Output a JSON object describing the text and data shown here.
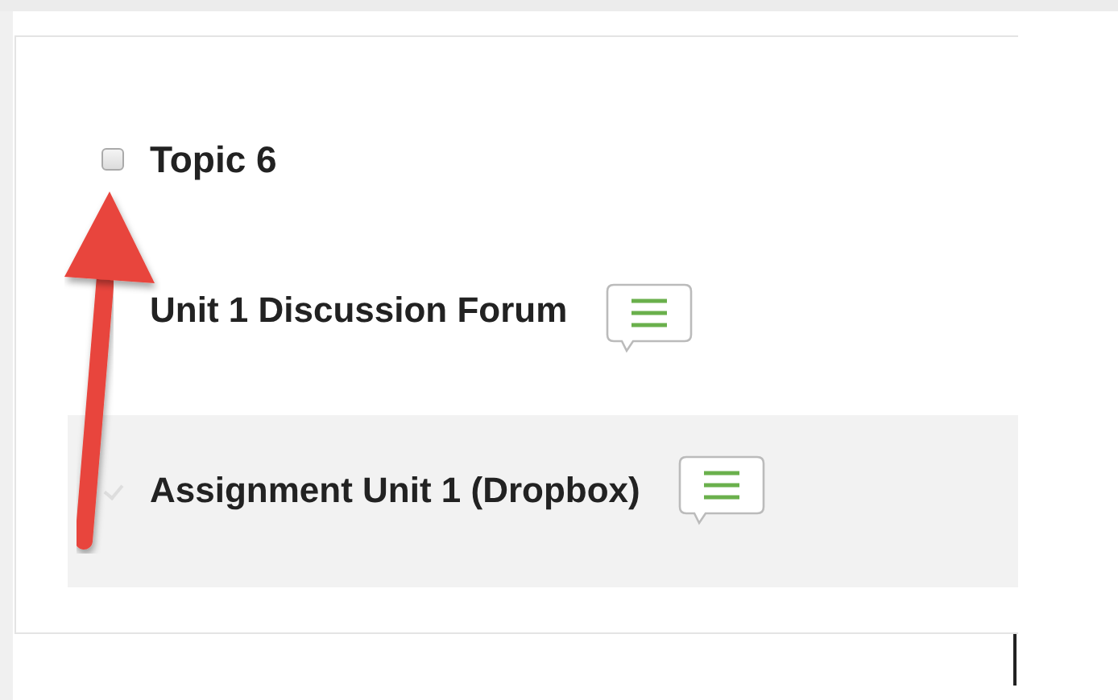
{
  "topic": {
    "title": "Topic 6",
    "checked": false
  },
  "items": [
    {
      "title": "Unit 1 Discussion Forum",
      "selected": false
    },
    {
      "title": "Assignment Unit 1 (Dropbox)",
      "selected": true
    }
  ]
}
